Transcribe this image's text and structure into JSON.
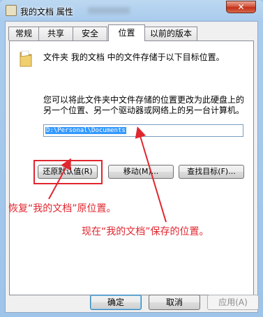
{
  "window": {
    "title": "我的文档 属性",
    "close_label": "✕"
  },
  "tabs": [
    {
      "label": "常规"
    },
    {
      "label": "共享"
    },
    {
      "label": "安全"
    },
    {
      "label": "位置"
    },
    {
      "label": "以前的版本"
    }
  ],
  "location": {
    "description": "文件夹 我的文档 中的文件存储于以下目标位置。",
    "info": "您可以将此文件夹中文件存储的位置更改为此硬盘上的另一个位置、另一个驱动器或网络上的另一台计算机。",
    "path": "D:\\Personal\\Documents",
    "restore_label": "还原默认值(R)",
    "move_label": "移动(M)...",
    "find_label": "查找目标(F)..."
  },
  "annotations": {
    "restore_note": "恢复“我的文档”原位置。",
    "current_note": "现在“我的文档”保存的位置。",
    "color": "#e0262e"
  },
  "footer": {
    "ok_label": "确定",
    "cancel_label": "取消",
    "apply_label": "应用(A)"
  }
}
